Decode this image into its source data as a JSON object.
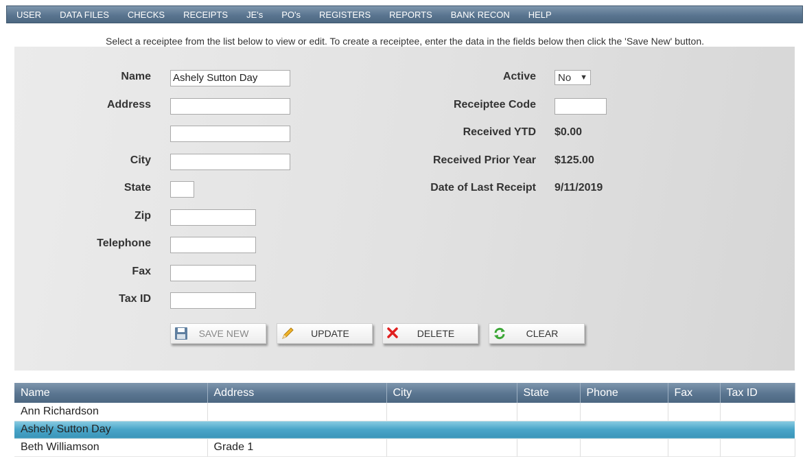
{
  "nav": [
    "USER",
    "DATA FILES",
    "CHECKS",
    "RECEIPTS",
    "JE's",
    "PO's",
    "REGISTERS",
    "REPORTS",
    "BANK RECON",
    "HELP"
  ],
  "instruction": "Select a receiptee from the list below to view or edit. To create a receiptee, enter the data in the fields below then click the 'Save New' button.",
  "form": {
    "name_label": "Name",
    "name_value": "Ashely Sutton Day",
    "address_label": "Address",
    "address1_value": "",
    "address2_value": "",
    "city_label": "City",
    "city_value": "",
    "state_label": "State",
    "state_value": "",
    "zip_label": "Zip",
    "zip_value": "",
    "telephone_label": "Telephone",
    "telephone_value": "",
    "fax_label": "Fax",
    "fax_value": "",
    "taxid_label": "Tax ID",
    "taxid_value": "",
    "active_label": "Active",
    "active_value": "No",
    "code_label": "Receiptee Code",
    "code_value": "",
    "ytd_label": "Received YTD",
    "ytd_value": "$0.00",
    "prior_label": "Received Prior Year",
    "prior_value": "$125.00",
    "last_label": "Date of Last Receipt",
    "last_value": "9/11/2019"
  },
  "buttons": {
    "save_new": "SAVE NEW",
    "update": "UPDATE",
    "delete": "DELETE",
    "clear": "CLEAR"
  },
  "table": {
    "headers": [
      "Name",
      "Address",
      "City",
      "State",
      "Phone",
      "Fax",
      "Tax ID"
    ],
    "rows": [
      [
        "Ann Richardson",
        "",
        "",
        "",
        "",
        "",
        ""
      ],
      [
        "Ashely Sutton Day",
        "",
        "",
        "",
        "",
        "",
        ""
      ],
      [
        "Beth Williamson",
        "Grade 1",
        "",
        "",
        "",
        "",
        ""
      ]
    ]
  },
  "colors": {
    "nav_bg": "#5a7590",
    "selected_row": "#49a5c8"
  }
}
